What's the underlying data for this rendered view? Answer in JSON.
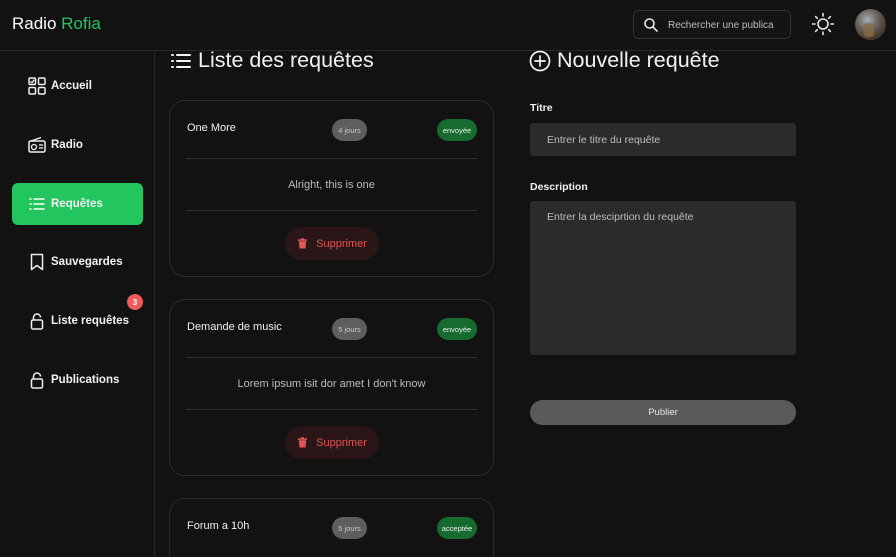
{
  "header": {
    "brand_part1": "Radio",
    "brand_part2": "Rofia",
    "search_placeholder": "Rechercher une publica"
  },
  "sidebar": {
    "items": [
      {
        "label": "Accueil",
        "icon": "grid-icon"
      },
      {
        "label": "Radio",
        "icon": "radio-icon"
      },
      {
        "label": "Requêtes",
        "icon": "list-icon",
        "active": true
      },
      {
        "label": "Sauvegardes",
        "icon": "bookmark-icon"
      },
      {
        "label": "Liste requêtes",
        "icon": "lock-icon",
        "badge": "3"
      },
      {
        "label": "Publications",
        "icon": "lock-icon"
      }
    ]
  },
  "requests": {
    "title": "Liste des requêtes",
    "cards": [
      {
        "title": "One More",
        "age": "4 jours",
        "status": "envoyée",
        "body": "Alright, this is one",
        "delete_label": "Supprimer"
      },
      {
        "title": "Demande de music",
        "age": "5 jours",
        "status": "envoyée",
        "body": "Lorem ipsum isit dor amet I don't know",
        "delete_label": "Supprimer"
      },
      {
        "title": "Forum a 10h",
        "age": "5 jours",
        "status": "acceptée"
      }
    ]
  },
  "form": {
    "title": "Nouvelle requête",
    "title_label": "Titre",
    "title_placeholder": "Entrer le titre du requête",
    "description_label": "Description",
    "description_placeholder": "Entrer la desciprtion du requête",
    "submit_label": "Publier"
  },
  "colors": {
    "accent": "#22c55e",
    "background": "#121212",
    "danger": "#e25555",
    "status_green": "#176b2f"
  }
}
